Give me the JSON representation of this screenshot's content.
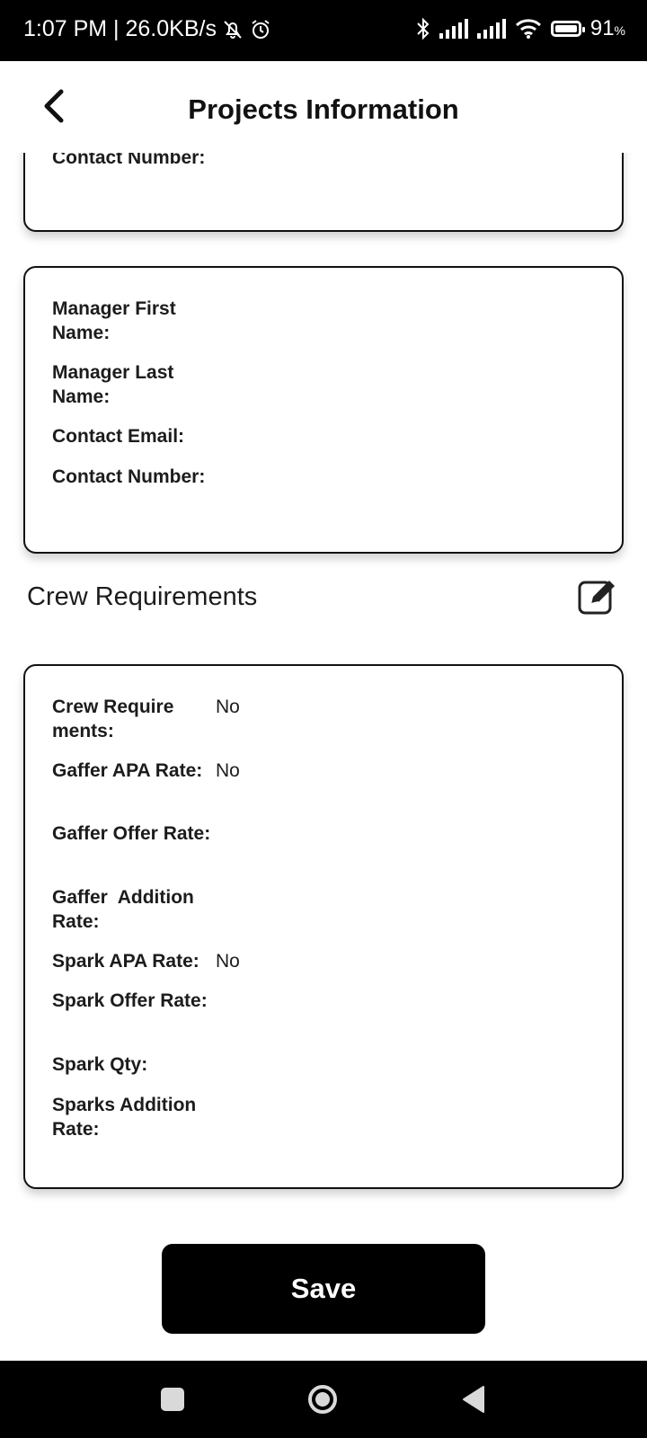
{
  "status_bar": {
    "time_speed": "1:07 PM | 26.0KB/s",
    "battery_percent": "91",
    "battery_symbol": "%",
    "icons": [
      "mute-bell-icon",
      "alarm-icon",
      "bluetooth-icon",
      "signal-icon",
      "signal-icon",
      "wifi-icon",
      "battery-icon"
    ]
  },
  "header": {
    "title": "Projects Information",
    "back_icon": "chevron-left-icon"
  },
  "card_top": {
    "fields": [
      {
        "label": "Contact Number:",
        "value": ""
      }
    ]
  },
  "card_manager": {
    "fields": [
      {
        "label": "Manager First Name:",
        "value": ""
      },
      {
        "label": "Manager Last Name:",
        "value": ""
      },
      {
        "label": "Contact Email:",
        "value": ""
      },
      {
        "label": "Contact Number:",
        "value": ""
      }
    ]
  },
  "crew_section": {
    "title": "Crew Requirements",
    "edit_icon": "edit-icon",
    "fields": [
      {
        "label": "Crew Require ments:",
        "value": "No"
      },
      {
        "label": "Gaffer APA Rate:",
        "value": "No"
      },
      {
        "label": "Gaffer Offer Rate:",
        "value": ""
      },
      {
        "label": "Gaffer  Addition Rate:",
        "value": ""
      },
      {
        "label": "Spark APA Rate:",
        "value": "No"
      },
      {
        "label": "Spark Offer Rate:",
        "value": ""
      },
      {
        "label": "Spark Qty:",
        "value": ""
      },
      {
        "label": "Sparks Addition Rate:",
        "value": ""
      }
    ]
  },
  "save_label": "Save",
  "nav_bar": {
    "icons": [
      "recents-square-icon",
      "home-circle-icon",
      "back-triangle-icon"
    ]
  }
}
